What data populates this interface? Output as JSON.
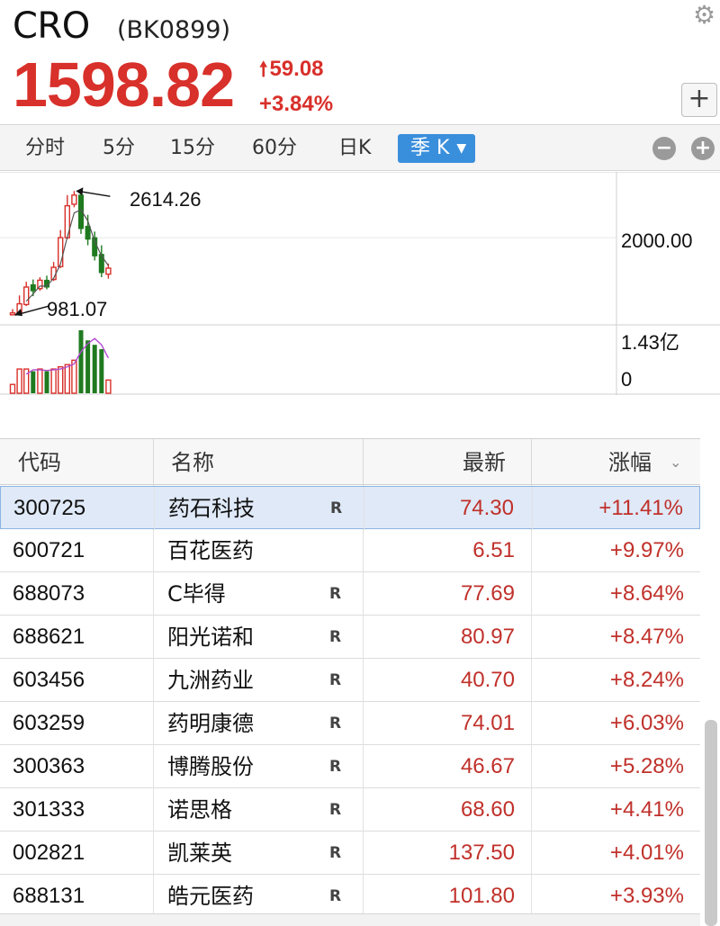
{
  "header": {
    "name": "CRO",
    "code": "(BK0899)",
    "price": "1598.82",
    "change_abs": "59.08",
    "change_pct": "+3.84%",
    "plus_label": "+"
  },
  "tabs": [
    {
      "label": "分时"
    },
    {
      "label": "5分"
    },
    {
      "label": "15分"
    },
    {
      "label": "60分"
    },
    {
      "label": "日K"
    },
    {
      "label": "季 K",
      "active": true
    }
  ],
  "chart": {
    "annotation_high": "2614.26",
    "annotation_low": "981.07",
    "price_axis_label": "2000.00",
    "volume_top_label": "1.43亿",
    "volume_bottom_label": "0"
  },
  "chart_data": {
    "type": "candlestick",
    "series": [
      {
        "name": "K",
        "candles": [
          {
            "open": 985,
            "close": 1010,
            "high": 1060,
            "low": 981.07,
            "color": "red"
          },
          {
            "open": 1010,
            "close": 1130,
            "high": 1240,
            "low": 1000,
            "color": "red"
          },
          {
            "open": 1120,
            "close": 1350,
            "high": 1420,
            "low": 1100,
            "color": "red"
          },
          {
            "open": 1380,
            "close": 1300,
            "high": 1450,
            "low": 1230,
            "color": "green"
          },
          {
            "open": 1330,
            "close": 1440,
            "high": 1480,
            "low": 1300,
            "color": "red"
          },
          {
            "open": 1440,
            "close": 1350,
            "high": 1500,
            "low": 1320,
            "color": "green"
          },
          {
            "open": 1450,
            "close": 1610,
            "high": 1680,
            "low": 1430,
            "color": "red"
          },
          {
            "open": 1620,
            "close": 2000,
            "high": 2100,
            "low": 1600,
            "color": "red"
          },
          {
            "open": 2000,
            "close": 2420,
            "high": 2560,
            "low": 1980,
            "color": "red"
          },
          {
            "open": 2440,
            "close": 2560,
            "high": 2614.26,
            "low": 2400,
            "color": "red"
          },
          {
            "open": 2560,
            "close": 2120,
            "high": 2614,
            "low": 2050,
            "color": "green"
          },
          {
            "open": 2150,
            "close": 1980,
            "high": 2300,
            "low": 1900,
            "color": "green"
          },
          {
            "open": 2000,
            "close": 1760,
            "high": 2080,
            "low": 1700,
            "color": "green"
          },
          {
            "open": 1780,
            "close": 1540,
            "high": 1900,
            "low": 1480,
            "color": "green"
          },
          {
            "open": 1520,
            "close": 1598.82,
            "high": 1660,
            "low": 1460,
            "color": "red"
          }
        ]
      }
    ],
    "volume": [
      0.2,
      0.55,
      0.55,
      0.5,
      0.55,
      0.5,
      0.55,
      0.6,
      0.65,
      0.75,
      1.43,
      1.2,
      1.1,
      1.0,
      0.3
    ],
    "y_marker": 2000.0,
    "y_range": [
      900,
      2700
    ],
    "volume_range": [
      0,
      1.43
    ],
    "high_label": "2614.26",
    "low_label": "981.07"
  },
  "table": {
    "headers": {
      "code": "代码",
      "name": "名称",
      "last": "最新",
      "pct": "涨幅"
    },
    "sort_icon": "chevron-down-icon",
    "rows": [
      {
        "code": "300725",
        "name": "药石科技",
        "r": "R",
        "last": "74.30",
        "pct": "+11.41%"
      },
      {
        "code": "600721",
        "name": "百花医药",
        "r": "",
        "last": "6.51",
        "pct": "+9.97%"
      },
      {
        "code": "688073",
        "name": "C毕得",
        "r": "R",
        "last": "77.69",
        "pct": "+8.64%"
      },
      {
        "code": "688621",
        "name": "阳光诺和",
        "r": "R",
        "last": "80.97",
        "pct": "+8.47%"
      },
      {
        "code": "603456",
        "name": "九洲药业",
        "r": "R",
        "last": "40.70",
        "pct": "+8.24%"
      },
      {
        "code": "603259",
        "name": "药明康德",
        "r": "R",
        "last": "74.01",
        "pct": "+6.03%"
      },
      {
        "code": "300363",
        "name": "博腾股份",
        "r": "R",
        "last": "46.67",
        "pct": "+5.28%"
      },
      {
        "code": "301333",
        "name": "诺思格",
        "r": "R",
        "last": "68.60",
        "pct": "+4.41%"
      },
      {
        "code": "002821",
        "name": "凯莱英",
        "r": "R",
        "last": "137.50",
        "pct": "+4.01%"
      },
      {
        "code": "688131",
        "name": "皓元医药",
        "r": "R",
        "last": "101.80",
        "pct": "+3.93%"
      }
    ]
  },
  "colors": {
    "up": "#d8302a",
    "down": "#1f7a1f",
    "accent": "#3a8fdc",
    "ma": "#b04bd0"
  }
}
